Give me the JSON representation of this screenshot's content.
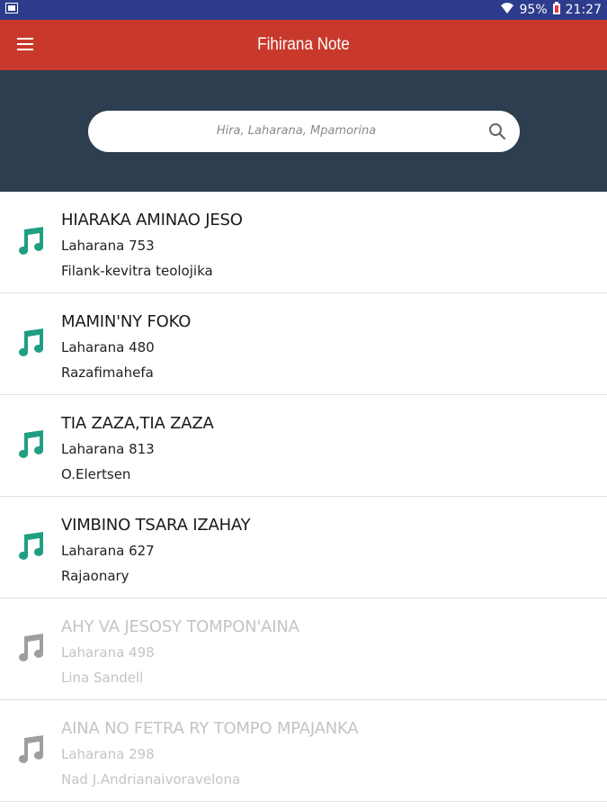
{
  "status_bar": {
    "battery": "95%",
    "time": "21:27"
  },
  "app_bar": {
    "title": "Fihirana Note"
  },
  "search": {
    "placeholder": "Hira, Laharana, Mpamorina"
  },
  "colors": {
    "accent_active": "#1f9e82",
    "accent_inactive": "#9e9e9e",
    "app_bar": "#c8392b",
    "search_bg": "#2c3e50"
  },
  "songs": [
    {
      "title": "HIARAKA AMINAO JESO",
      "number": "Laharana 753",
      "author": "Filank-kevitra teolojika",
      "enabled": true
    },
    {
      "title": "MAMIN'NY FOKO",
      "number": "Laharana 480",
      "author": "Razafimahefa",
      "enabled": true
    },
    {
      "title": "TIA ZAZA,TIA ZAZA",
      "number": "Laharana 813",
      "author": "O.Elertsen",
      "enabled": true
    },
    {
      "title": "VIMBINO TSARA IZAHAY",
      "number": "Laharana 627",
      "author": "Rajaonary",
      "enabled": true
    },
    {
      "title": "AHY VA JESOSY TOMPON'AINA",
      "number": "Laharana 498",
      "author": "Lina Sandell",
      "enabled": false
    },
    {
      "title": "AINA NO FETRA RY TOMPO MPAJANKA",
      "number": "Laharana 298",
      "author": "Nad J.Andrianaivoravelona",
      "enabled": false
    }
  ]
}
